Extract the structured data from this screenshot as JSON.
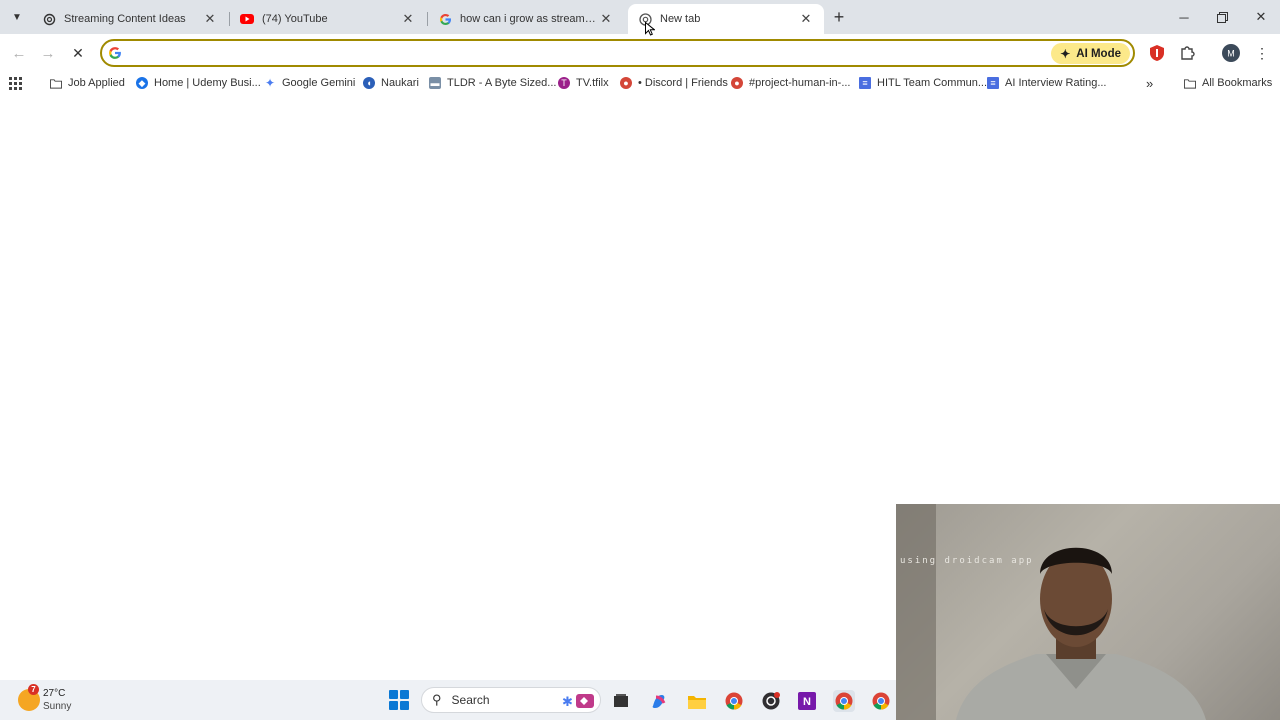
{
  "tabs": [
    {
      "title": "Streaming Content Ideas",
      "favicon": "chatgpt-icon",
      "active": false
    },
    {
      "title": "(74) YouTube",
      "favicon": "youtube-icon",
      "active": false
    },
    {
      "title": "how can i grow as streamer on",
      "favicon": "google-icon",
      "active": false
    },
    {
      "title": "New tab",
      "favicon": "chrome-icon",
      "active": true
    }
  ],
  "omnibox": {
    "value": "",
    "placeholder": "",
    "ai_mode_label": "AI Mode"
  },
  "bookmarks": [
    {
      "label": "Job Applied",
      "icon": "folder-icon"
    },
    {
      "label": "Home | Udemy Busi...",
      "icon": "udemy-icon"
    },
    {
      "label": "Google Gemini",
      "icon": "gemini-icon"
    },
    {
      "label": "Naukari",
      "icon": "naukri-icon"
    },
    {
      "label": "TLDR - A Byte Sized...",
      "icon": "tldr-icon"
    },
    {
      "label": "TV.tfilx",
      "icon": "tv-icon"
    },
    {
      "label": "• Discord | Friends",
      "icon": "discord-icon"
    },
    {
      "label": "#project-human-in-...",
      "icon": "slack-icon"
    },
    {
      "label": "HITL Team Commun...",
      "icon": "doc-icon"
    },
    {
      "label": "AI Interview Rating...",
      "icon": "doc-icon"
    }
  ],
  "all_bookmarks_label": "All Bookmarks",
  "webcam": {
    "overlay_text": "using droidcam app"
  },
  "weather": {
    "temp": "27°C",
    "condition": "Sunny",
    "badge": "7"
  },
  "taskbar": {
    "search_label": "Search"
  },
  "colors": {
    "tabstrip": "#dfe3e8",
    "omnibox_border": "#a08a00",
    "ai_mode_bg": "#fce98a",
    "taskbar": "#eef1f5"
  }
}
